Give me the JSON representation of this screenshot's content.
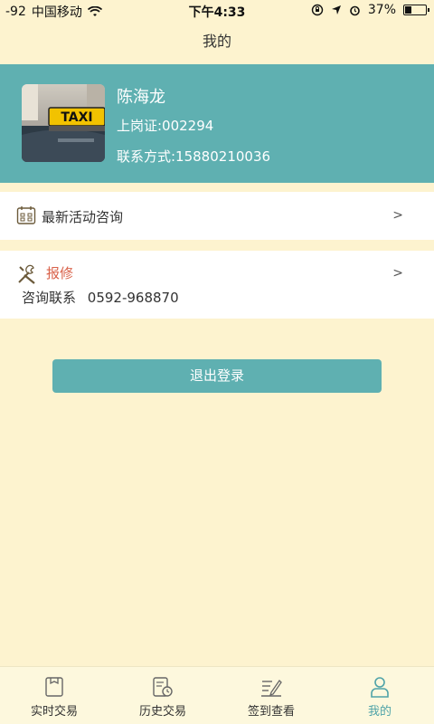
{
  "status_bar": {
    "signal": "-92",
    "carrier": "中国移动",
    "time": "下午4:33",
    "battery": "37%",
    "battery_level": 0.37
  },
  "nav": {
    "title": "我的"
  },
  "profile": {
    "name": "陈海龙",
    "license": "上岗证:002294",
    "contact": "联系方式:15880210036",
    "avatar_sign_text": "TAXI"
  },
  "activity": {
    "label": "最新活动咨询",
    "chevron": ">"
  },
  "repair": {
    "label": "报修",
    "consult_label": "咨询联系",
    "consult_phone": "0592-968870",
    "chevron": ">"
  },
  "logout": {
    "label": "退出登录"
  },
  "tabs": [
    {
      "label": "实时交易",
      "icon": "realtime-trade-icon",
      "active": false
    },
    {
      "label": "历史交易",
      "icon": "history-trade-icon",
      "active": false
    },
    {
      "label": "签到查看",
      "icon": "signin-view-icon",
      "active": false
    },
    {
      "label": "我的",
      "icon": "my-profile-icon",
      "active": true
    }
  ],
  "colors": {
    "background": "#fdf3cf",
    "accent": "#5fb0b1",
    "repair_label": "#d9624a",
    "tab_active": "#4fa3a8"
  }
}
